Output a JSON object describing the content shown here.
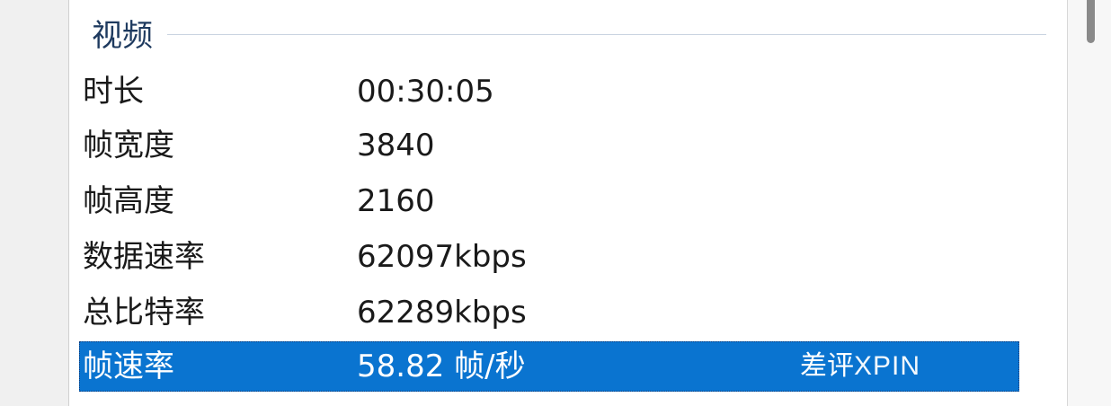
{
  "section": {
    "title": "视频"
  },
  "rows": [
    {
      "label": "时长",
      "value": "00:30:05"
    },
    {
      "label": "帧宽度",
      "value": "3840"
    },
    {
      "label": "帧高度",
      "value": "2160"
    },
    {
      "label": "数据速率",
      "value": "62097kbps"
    },
    {
      "label": "总比特率",
      "value": "62289kbps"
    },
    {
      "label": "帧速率",
      "value": "58.82 帧/秒"
    }
  ],
  "watermark": {
    "prefix": "差评",
    "brand": "XPIN"
  },
  "colors": {
    "selection": "#0a74d0",
    "section_title": "#1e3a5f"
  }
}
